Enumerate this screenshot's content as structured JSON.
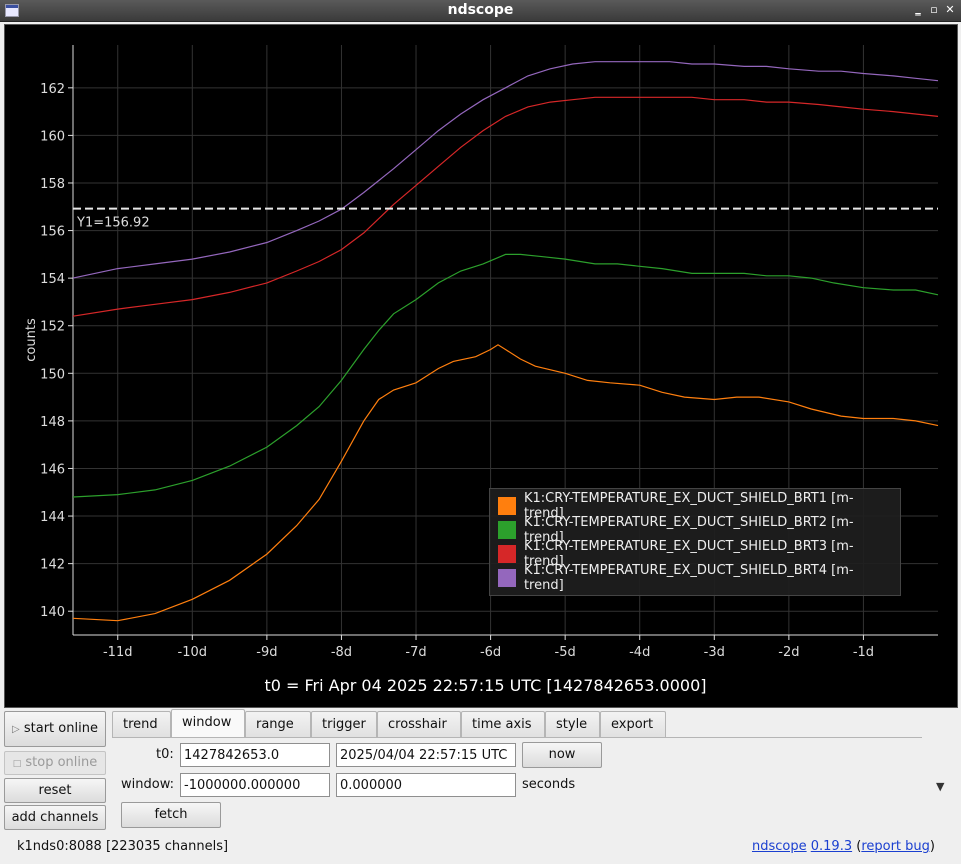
{
  "window": {
    "title": "ndscope"
  },
  "plot": {
    "ylabel": "counts",
    "cursor_label": "Y1=156.92",
    "t0_caption": "t0 = Fri Apr 04 2025 22:57:15 UTC [1427842653.0000]",
    "colors": {
      "background": "#000000",
      "grid": "#333333",
      "axis": "#dddddd",
      "cursor": "#e8e8e8"
    }
  },
  "chart_data": {
    "type": "line",
    "xlabel": "",
    "ylabel": "counts",
    "xlim": [
      -11.6,
      0
    ],
    "ylim": [
      139,
      163.8
    ],
    "x_ticks": [
      "-11d",
      "-10d",
      "-9d",
      "-8d",
      "-7d",
      "-6d",
      "-5d",
      "-4d",
      "-3d",
      "-2d",
      "-1d"
    ],
    "y_ticks": [
      "140",
      "142",
      "144",
      "146",
      "148",
      "150",
      "152",
      "154",
      "156",
      "158",
      "160",
      "162"
    ],
    "legend_position": "bottom-right",
    "grid": true,
    "cursor_y": 156.92,
    "series": [
      {
        "name": "K1:CRY-TEMPERATURE_EX_DUCT_SHIELD_BRT1 [m-trend]",
        "color": "#ff7f0e",
        "x": [
          -11.6,
          -11,
          -10.5,
          -10,
          -9.5,
          -9,
          -8.6,
          -8.3,
          -8,
          -7.7,
          -7.5,
          -7.3,
          -7,
          -6.7,
          -6.5,
          -6.2,
          -6,
          -5.9,
          -5.8,
          -5.6,
          -5.4,
          -5,
          -4.7,
          -4.4,
          -4,
          -3.7,
          -3.4,
          -3,
          -2.7,
          -2.4,
          -2,
          -1.7,
          -1.3,
          -1,
          -0.6,
          -0.3,
          0
        ],
        "y": [
          139.7,
          139.6,
          139.9,
          140.5,
          141.3,
          142.4,
          143.6,
          144.7,
          146.3,
          148.0,
          148.9,
          149.3,
          149.6,
          150.2,
          150.5,
          150.7,
          151.0,
          151.2,
          151.0,
          150.6,
          150.3,
          150.0,
          149.7,
          149.6,
          149.5,
          149.2,
          149.0,
          148.9,
          149.0,
          149.0,
          148.8,
          148.5,
          148.2,
          148.1,
          148.1,
          148.0,
          147.8
        ]
      },
      {
        "name": "K1:CRY-TEMPERATURE_EX_DUCT_SHIELD_BRT2 [m-trend]",
        "color": "#2ca02c",
        "x": [
          -11.6,
          -11,
          -10.5,
          -10,
          -9.5,
          -9,
          -8.6,
          -8.3,
          -8,
          -7.7,
          -7.5,
          -7.3,
          -7,
          -6.7,
          -6.4,
          -6.1,
          -5.8,
          -5.6,
          -5.3,
          -5,
          -4.6,
          -4.3,
          -4,
          -3.7,
          -3.3,
          -3,
          -2.6,
          -2.3,
          -2,
          -1.7,
          -1.4,
          -1,
          -0.6,
          -0.3,
          0
        ],
        "y": [
          144.8,
          144.9,
          145.1,
          145.5,
          146.1,
          146.9,
          147.8,
          148.6,
          149.7,
          151.0,
          151.8,
          152.5,
          153.1,
          153.8,
          154.3,
          154.6,
          155.0,
          155.0,
          154.9,
          154.8,
          154.6,
          154.6,
          154.5,
          154.4,
          154.2,
          154.2,
          154.2,
          154.1,
          154.1,
          154.0,
          153.8,
          153.6,
          153.5,
          153.5,
          153.3
        ]
      },
      {
        "name": "K1:CRY-TEMPERATURE_EX_DUCT_SHIELD_BRT3 [m-trend]",
        "color": "#d62728",
        "x": [
          -11.6,
          -11,
          -10.5,
          -10,
          -9.5,
          -9,
          -8.6,
          -8.3,
          -8,
          -7.7,
          -7.5,
          -7.3,
          -7,
          -6.7,
          -6.4,
          -6.1,
          -5.8,
          -5.5,
          -5.2,
          -4.9,
          -4.6,
          -4.3,
          -4,
          -3.6,
          -3.3,
          -3,
          -2.6,
          -2.3,
          -2,
          -1.6,
          -1.3,
          -1,
          -0.6,
          -0.3,
          0
        ],
        "y": [
          152.4,
          152.7,
          152.9,
          153.1,
          153.4,
          153.8,
          154.3,
          154.7,
          155.2,
          155.9,
          156.5,
          157.1,
          157.9,
          158.7,
          159.5,
          160.2,
          160.8,
          161.2,
          161.4,
          161.5,
          161.6,
          161.6,
          161.6,
          161.6,
          161.6,
          161.5,
          161.5,
          161.4,
          161.4,
          161.3,
          161.2,
          161.1,
          161.0,
          160.9,
          160.8
        ]
      },
      {
        "name": "K1:CRY-TEMPERATURE_EX_DUCT_SHIELD_BRT4 [m-trend]",
        "color": "#9467bd",
        "x": [
          -11.6,
          -11,
          -10.5,
          -10,
          -9.5,
          -9,
          -8.6,
          -8.3,
          -8,
          -7.7,
          -7.5,
          -7.3,
          -7,
          -6.7,
          -6.4,
          -6.1,
          -5.8,
          -5.5,
          -5.2,
          -4.9,
          -4.6,
          -4.3,
          -4,
          -3.6,
          -3.3,
          -3,
          -2.6,
          -2.3,
          -2,
          -1.6,
          -1.3,
          -1,
          -0.6,
          -0.3,
          0
        ],
        "y": [
          154.0,
          154.4,
          154.6,
          154.8,
          155.1,
          155.5,
          156.0,
          156.4,
          156.9,
          157.6,
          158.1,
          158.6,
          159.4,
          160.2,
          160.9,
          161.5,
          162.0,
          162.5,
          162.8,
          163.0,
          163.1,
          163.1,
          163.1,
          163.1,
          163.0,
          163.0,
          162.9,
          162.9,
          162.8,
          162.7,
          162.7,
          162.6,
          162.5,
          162.4,
          162.3
        ]
      }
    ]
  },
  "controls": {
    "start_online": "start online",
    "stop_online": "stop online",
    "reset": "reset",
    "add_channels": "add channels",
    "tabs": [
      "trend",
      "window",
      "range",
      "trigger",
      "crosshair",
      "time axis",
      "style",
      "export"
    ],
    "active_tab": "window",
    "t0_label": "t0:",
    "t0_gps": "1427842653.0",
    "t0_utc": "2025/04/04 22:57:15 UTC",
    "now_button": "now",
    "window_label": "window:",
    "window_start": "-1000000.000000",
    "window_end": "0.000000",
    "seconds_label": "seconds",
    "fetch_button": "fetch"
  },
  "status": {
    "server": "k1nds0:8088",
    "channels": "[223035 channels]",
    "app_name": "ndscope",
    "version": "0.19.3",
    "report_bug": "report bug"
  }
}
